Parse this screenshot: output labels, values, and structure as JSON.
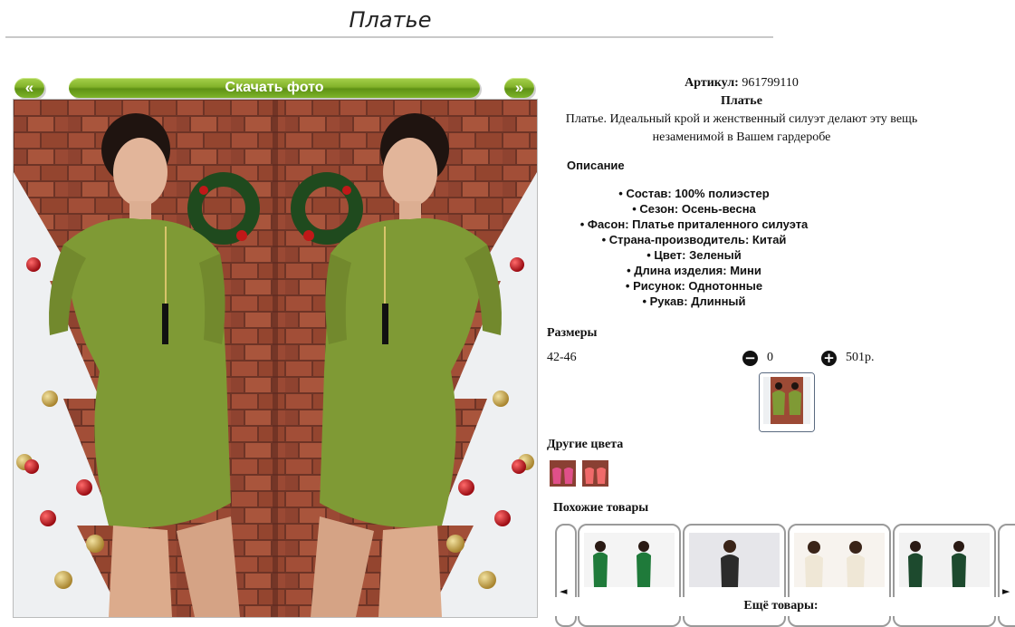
{
  "page": {
    "title": "Платье"
  },
  "gallery": {
    "prev_label": "«",
    "download_label": "Скачать фото",
    "next_label": "»"
  },
  "product": {
    "article_label": "Артикул:",
    "article_value": "961799110",
    "name": "Платье",
    "summary": "Платье. Идеальный крой и женственный силуэт делают эту вещь незаменимой в Вашем гардеробе"
  },
  "description": {
    "heading": "Описание",
    "items": [
      "Состав: 100% полиэстер",
      "Сезон: Осень-весна",
      "Фасон: Платье приталенного силуэта",
      "Страна-производитель: Китай",
      "Цвет: Зеленый",
      "Длина изделия: Мини",
      "Рисунок: Однотонные",
      "Рукав: Длинный"
    ]
  },
  "sizes": {
    "heading": "Размеры",
    "rows": [
      {
        "size": "42-46",
        "quantity": "0",
        "price": "501р."
      }
    ]
  },
  "other_colors": {
    "heading": "Другие цвета",
    "swatches": [
      "pink-dress",
      "coral-dress"
    ]
  },
  "similar": {
    "heading": "Похожие товары",
    "more_label": "Ещё товары:",
    "prev_arrow": "◄",
    "next_arrow": "►"
  },
  "colors": {
    "accent_green": "#7db42a",
    "dress_green": "#7f9a35",
    "brick": "#9c4a35"
  },
  "icons": {
    "minus": "−",
    "plus": "+"
  }
}
